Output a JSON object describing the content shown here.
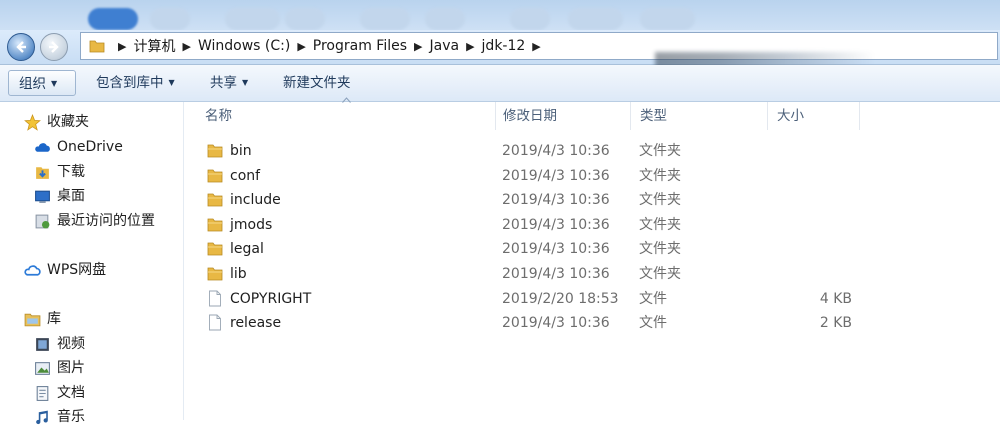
{
  "address": {
    "crumbs": [
      "计算机",
      "Windows (C:)",
      "Program Files",
      "Java",
      "jdk-12"
    ]
  },
  "toolbar": {
    "organize": "组织",
    "include_in_library": "包含到库中",
    "share": "共享",
    "new_folder": "新建文件夹"
  },
  "sidebar": {
    "favorites": "收藏夹",
    "onedrive": "OneDrive",
    "downloads": "下载",
    "desktop": "桌面",
    "recent": "最近访问的位置",
    "wps": "WPS网盘",
    "libraries": "库",
    "videos": "视频",
    "pictures": "图片",
    "documents": "文档",
    "music": "音乐"
  },
  "columns": {
    "name": "名称",
    "date": "修改日期",
    "type": "类型",
    "size": "大小"
  },
  "files": [
    {
      "name": "bin",
      "date": "2019/4/3 10:36",
      "type": "文件夹",
      "size": "",
      "kind": "folder"
    },
    {
      "name": "conf",
      "date": "2019/4/3 10:36",
      "type": "文件夹",
      "size": "",
      "kind": "folder"
    },
    {
      "name": "include",
      "date": "2019/4/3 10:36",
      "type": "文件夹",
      "size": "",
      "kind": "folder"
    },
    {
      "name": "jmods",
      "date": "2019/4/3 10:36",
      "type": "文件夹",
      "size": "",
      "kind": "folder"
    },
    {
      "name": "legal",
      "date": "2019/4/3 10:36",
      "type": "文件夹",
      "size": "",
      "kind": "folder"
    },
    {
      "name": "lib",
      "date": "2019/4/3 10:36",
      "type": "文件夹",
      "size": "",
      "kind": "folder"
    },
    {
      "name": "COPYRIGHT",
      "date": "2019/2/20 18:53",
      "type": "文件",
      "size": "4 KB",
      "kind": "file"
    },
    {
      "name": "release",
      "date": "2019/4/3 10:36",
      "type": "文件",
      "size": "2 KB",
      "kind": "file"
    }
  ],
  "colors": {
    "folder": "#e8b844",
    "accent": "#3f7fd1"
  }
}
